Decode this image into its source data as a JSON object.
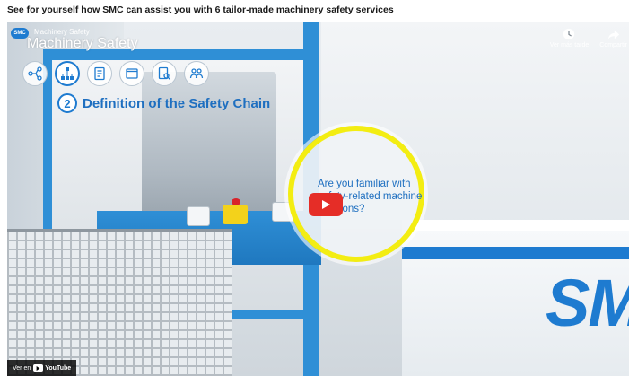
{
  "page": {
    "heading": "See for yourself how SMC can assist you with 6 tailor-made machinery safety services"
  },
  "video": {
    "brand_badge": "SMC",
    "brand_subtitle": "Machinery Safety",
    "brand_title": "Machinery Safety",
    "chapter_number": "2",
    "chapter_title": "Definition of the Safety Chain",
    "question": "Are you familiar with safety-related machine functions?",
    "actions": [
      {
        "label": "Ver más tarde",
        "icon": "clock-icon"
      },
      {
        "label": "Compartir",
        "icon": "share-icon"
      }
    ],
    "watch_on_label": "Ver en",
    "watch_on_brand": "YouTube",
    "scene_logo": "SM",
    "step_icons": [
      "network-icon",
      "hierarchy-icon",
      "document-icon",
      "window-icon",
      "document-search-icon",
      "people-icon"
    ],
    "active_step": 2
  },
  "colors": {
    "accent_blue": "#1e7bd0",
    "highlight_yellow": "#f3ed12",
    "play_red": "#e52d27"
  }
}
